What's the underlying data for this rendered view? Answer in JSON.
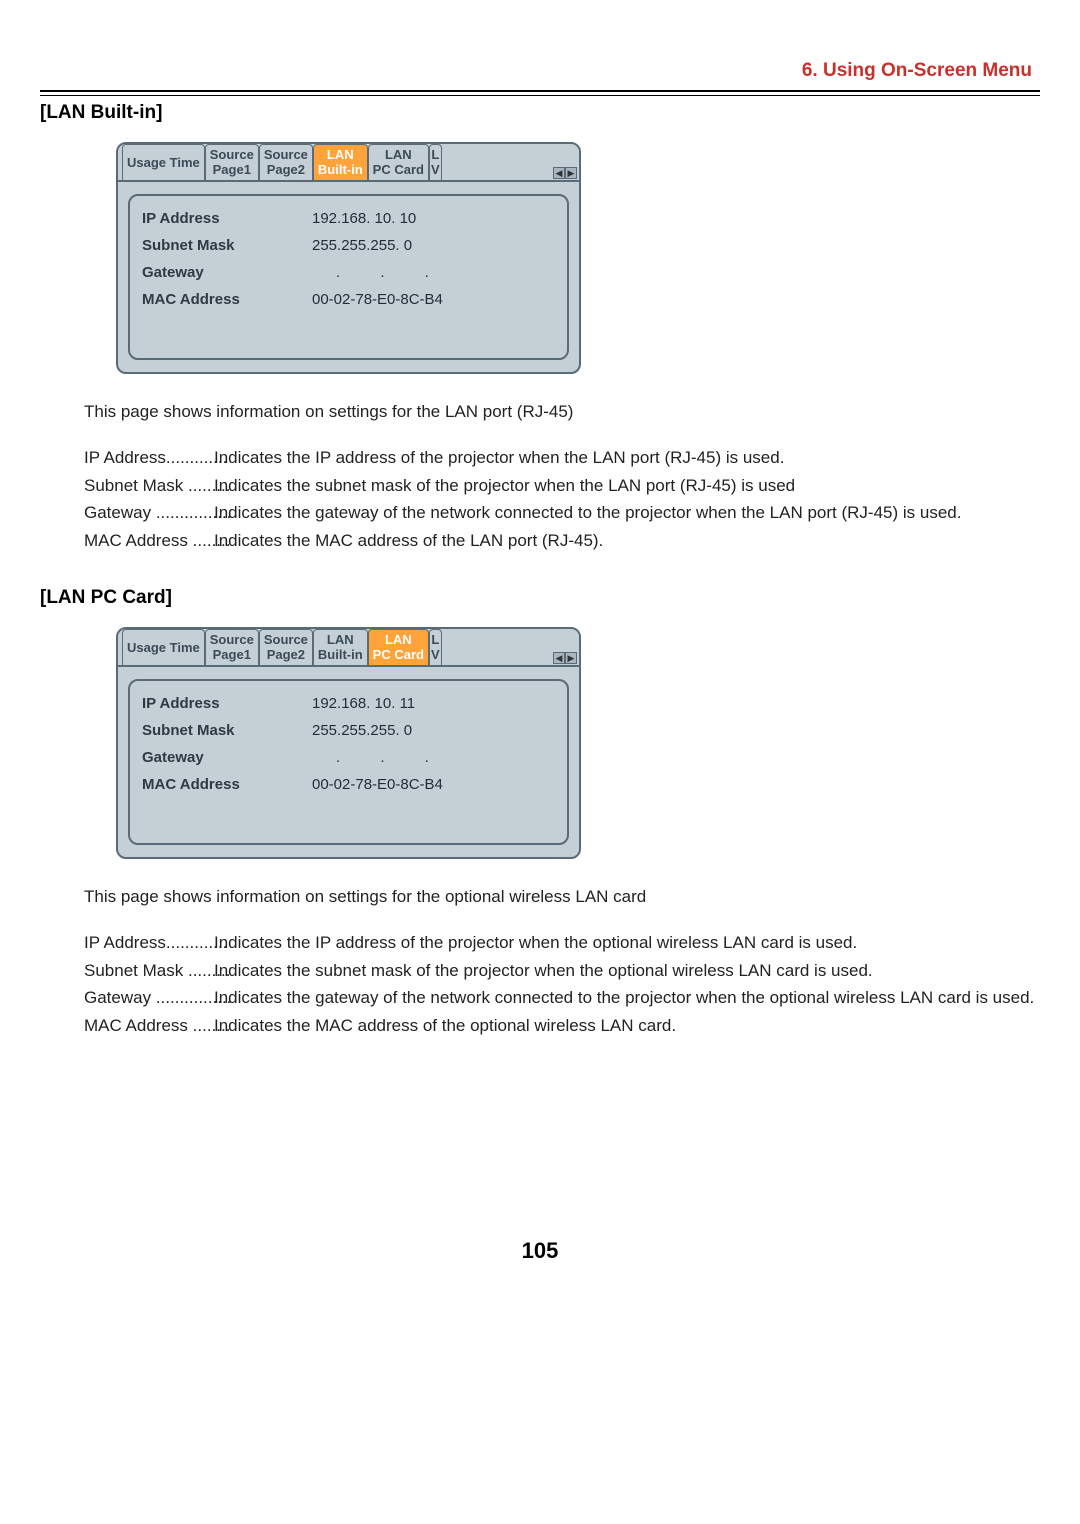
{
  "header": {
    "section_title": "6. Using On-Screen Menu"
  },
  "lan_builtin": {
    "heading": "[LAN Built-in]",
    "tabs": {
      "usage_time": "Usage Time",
      "source1_top": "Source",
      "source1_bot": "Page1",
      "source2_top": "Source",
      "source2_bot": "Page2",
      "lan_builtin_top": "LAN",
      "lan_builtin_bot": "Built-in",
      "lan_pccard_top": "LAN",
      "lan_pccard_bot": "PC Card",
      "last_top": "L",
      "last_bot": "V"
    },
    "panel": {
      "ip_label": "IP Address",
      "ip_value": "192.168. 10. 10",
      "subnet_label": "Subnet Mask",
      "subnet_value": "255.255.255.  0",
      "gateway_label": "Gateway",
      "gateway_value": ". . .",
      "mac_label": "MAC Address",
      "mac_value": "00-02-78-E0-8C-B4"
    },
    "desc_intro": "This page shows information on settings for the LAN port (RJ-45)",
    "defs": [
      {
        "term": "IP Address",
        "dots": ".............",
        "desc": "Indicates the IP address of the projector when the LAN port (RJ-45) is used."
      },
      {
        "term": "Subnet Mask",
        "dots": ".........",
        "desc": "Indicates the subnet mask of the projector when the LAN port (RJ-45) is used"
      },
      {
        "term": "Gateway",
        "dots": "................",
        "desc": "Indicates the gateway of the network connected to the projector when the LAN port (RJ-45) is used."
      },
      {
        "term": "MAC Address",
        "dots": "........",
        "desc": "Indicates the MAC address of the LAN port (RJ-45)."
      }
    ]
  },
  "lan_pccard": {
    "heading": "[LAN PC Card]",
    "tabs": {
      "usage_time": "Usage Time",
      "source1_top": "Source",
      "source1_bot": "Page1",
      "source2_top": "Source",
      "source2_bot": "Page2",
      "lan_builtin_top": "LAN",
      "lan_builtin_bot": "Built-in",
      "lan_pccard_top": "LAN",
      "lan_pccard_bot": "PC Card",
      "last_top": "L",
      "last_bot": "V"
    },
    "panel": {
      "ip_label": "IP Address",
      "ip_value": "192.168. 10. 11",
      "subnet_label": "Subnet Mask",
      "subnet_value": "255.255.255.  0",
      "gateway_label": "Gateway",
      "gateway_value": ". . .",
      "mac_label": "MAC Address",
      "mac_value": "00-02-78-E0-8C-B4"
    },
    "desc_intro": "This page shows information on settings for the optional wireless LAN card",
    "defs": [
      {
        "term": "IP Address",
        "dots": ".............",
        "desc": "Indicates the IP address of the projector when the optional wireless LAN card is used."
      },
      {
        "term": "Subnet Mask",
        "dots": ".........",
        "desc": "Indicates the subnet mask of the projector when the optional wireless LAN card is used."
      },
      {
        "term": "Gateway",
        "dots": "................",
        "desc": "Indicates the gateway of the network connected to the projector when the optional wireless LAN card is used."
      },
      {
        "term": "MAC Address",
        "dots": "........",
        "desc": "Indicates the MAC address of the optional wireless LAN card."
      }
    ]
  },
  "page_number": "105"
}
